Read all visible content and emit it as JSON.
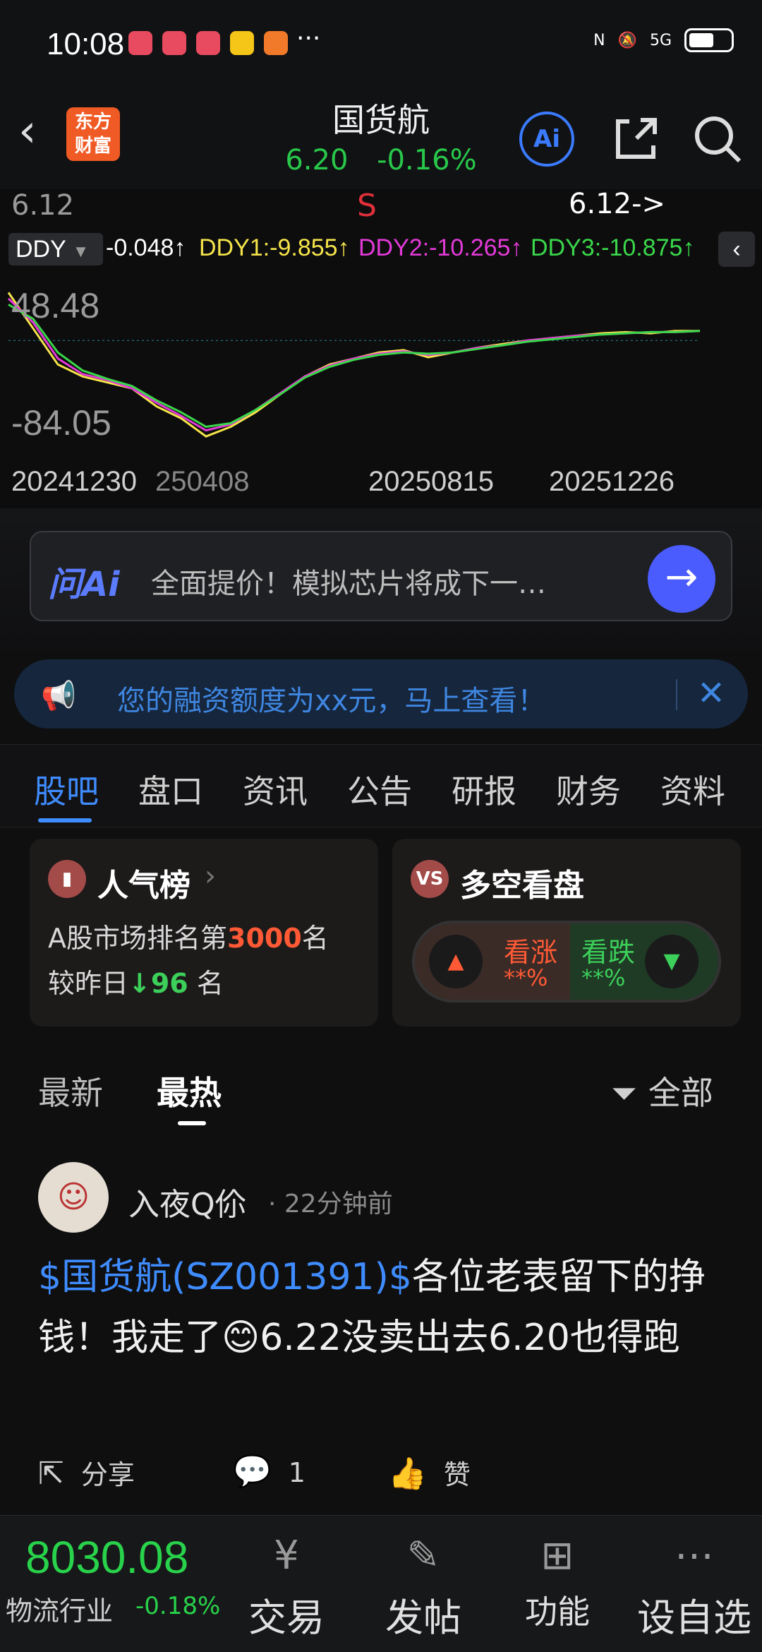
{
  "status": {
    "time": "10:08",
    "dots": "···",
    "net": "5G"
  },
  "header": {
    "title": "国货航",
    "price": "6.20",
    "change": "-0.16%",
    "logo_line1": "东方",
    "logo_line2": "财富",
    "ai_label": "Ai"
  },
  "chart": {
    "price_top": "6.12",
    "sell_marker": "S",
    "price_pointer": "6.12->",
    "indicator": "DDY",
    "v0": "-0.048↑",
    "ddy1": "DDY1:-9.855↑",
    "ddy2": "DDY2:-10.265↑",
    "ddy3": "DDY3:-10.875↑",
    "ymax": "48.48",
    "ymin": "-84.05",
    "x_labels": [
      "20241230",
      "250408",
      "20250815",
      "20251226"
    ]
  },
  "chart_data": {
    "type": "line",
    "ylim": [
      -84.05,
      48.48
    ],
    "series": [
      {
        "name": "DDY1",
        "color": "#f5e44a",
        "values": [
          40,
          10,
          -20,
          -30,
          -35,
          -40,
          -55,
          -65,
          -80,
          -72,
          -60,
          -45,
          -30,
          -20,
          -15,
          -10,
          -8,
          -14,
          -10,
          -6,
          -3,
          0,
          2,
          4,
          6,
          7,
          6,
          8,
          8
        ]
      },
      {
        "name": "DDY2",
        "color": "#e43ad8",
        "values": [
          35,
          15,
          -15,
          -28,
          -33,
          -40,
          -52,
          -63,
          -75,
          -70,
          -58,
          -44,
          -30,
          -21,
          -15,
          -11,
          -9,
          -12,
          -10,
          -6,
          -4,
          0,
          2,
          4,
          5,
          6,
          7,
          7,
          8
        ]
      },
      {
        "name": "DDY3",
        "color": "#3ad84a",
        "values": [
          30,
          18,
          -10,
          -25,
          -32,
          -38,
          -50,
          -60,
          -72,
          -69,
          -58,
          -45,
          -31,
          -22,
          -16,
          -12,
          -10,
          -11,
          -10,
          -7,
          -4,
          -1,
          1,
          3,
          5,
          6,
          7,
          7,
          8
        ]
      }
    ]
  },
  "ask": {
    "brand": "问Ai",
    "question": "全面提价！模拟芯片将成下一…"
  },
  "banner": {
    "text": "您的融资额度为xx元，马上查看！"
  },
  "tabs": [
    "股吧",
    "盘口",
    "资讯",
    "公告",
    "研报",
    "财务",
    "资料"
  ],
  "popularity": {
    "title": "人气榜",
    "rank_prefix": "A股市场排名第",
    "rank": "3000",
    "rank_suffix": "名",
    "delta_prefix": "较昨日",
    "delta": "96",
    "delta_suffix": "名"
  },
  "bullbear": {
    "title": "多空看盘",
    "icon": "VS",
    "up_label": "看涨",
    "up_value": "**%",
    "down_label": "看跌",
    "down_value": "**%"
  },
  "sort": {
    "latest": "最新",
    "hot": "最热",
    "filter": "全部"
  },
  "post": {
    "author": "入夜Q伱",
    "time": "· 22分钟前",
    "tag": "$国货航(SZ001391)$",
    "text": "各位老表留下的挣钱！我走了😊6.22没卖出去6.20也得跑",
    "share": "分享",
    "comments": "1",
    "like": "赞"
  },
  "bottom": {
    "index_value": "8030.08",
    "index_name": "物流行业",
    "index_change": "-0.18%",
    "nav": [
      "交易",
      "发帖",
      "功能",
      "设自选"
    ]
  }
}
